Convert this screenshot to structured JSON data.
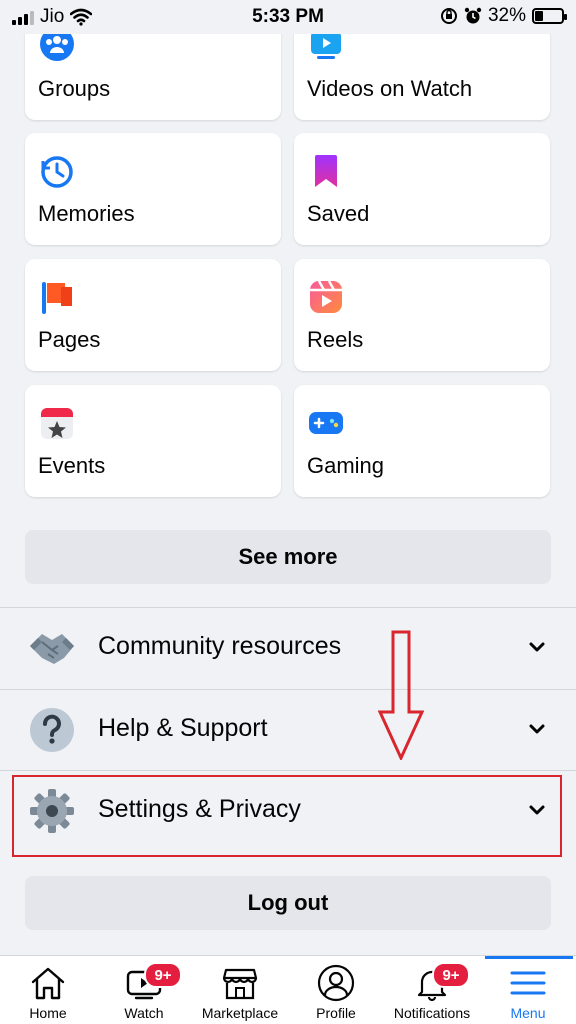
{
  "status_bar": {
    "carrier": "Jio",
    "time": "5:33 PM",
    "battery": "32%",
    "battery_level": 0.32
  },
  "shortcuts": [
    {
      "label": "Groups",
      "icon": "groups-icon"
    },
    {
      "label": "Videos on Watch",
      "icon": "video-icon"
    },
    {
      "label": "Memories",
      "icon": "memories-icon"
    },
    {
      "label": "Saved",
      "icon": "bookmark-icon"
    },
    {
      "label": "Pages",
      "icon": "flag-icon"
    },
    {
      "label": "Reels",
      "icon": "reels-icon"
    },
    {
      "label": "Events",
      "icon": "calendar-icon"
    },
    {
      "label": "Gaming",
      "icon": "gamepad-icon"
    }
  ],
  "see_more_label": "See more",
  "menu_rows": [
    {
      "label": "Community resources",
      "icon": "handshake-icon"
    },
    {
      "label": "Help & Support",
      "icon": "question-icon"
    },
    {
      "label": "Settings & Privacy",
      "icon": "gear-icon"
    }
  ],
  "logout_label": "Log out",
  "tabs": [
    {
      "label": "Home",
      "icon": "home-icon"
    },
    {
      "label": "Watch",
      "icon": "watch-icon",
      "badge": "9+"
    },
    {
      "label": "Marketplace",
      "icon": "marketplace-icon"
    },
    {
      "label": "Profile",
      "icon": "profile-icon"
    },
    {
      "label": "Notifications",
      "icon": "bell-icon",
      "badge": "9+"
    },
    {
      "label": "Menu",
      "icon": "menu-icon",
      "active": true
    }
  ],
  "colors": {
    "accent": "#1877F2",
    "badge": "#E41E3F",
    "annotation": "#D9262E"
  }
}
